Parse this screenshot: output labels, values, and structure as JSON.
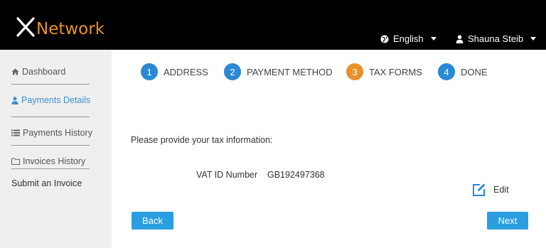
{
  "brand": {
    "logo_x": "X",
    "logo_text": "Network",
    "logo_color": "#e8912a"
  },
  "header": {
    "language": {
      "label": "English",
      "icon": "globe-icon"
    },
    "user": {
      "label": "Shauna Steib",
      "icon": "user-icon"
    }
  },
  "sidebar": {
    "items": [
      {
        "label": "Dashboard",
        "icon": "home-icon",
        "active": false
      },
      {
        "label": "Payments Details",
        "icon": "user-icon",
        "active": true
      },
      {
        "label": "Payments History",
        "icon": "list-icon",
        "active": false
      },
      {
        "label": "Invoices History",
        "icon": "folder-icon",
        "active": false
      },
      {
        "label": "Submit an Invoice",
        "icon": "",
        "active": false
      }
    ]
  },
  "steps": [
    {
      "num": "1",
      "label": "ADDRESS",
      "state": "done",
      "color": "#2a88d4"
    },
    {
      "num": "2",
      "label": "PAYMENT METHOD",
      "state": "done",
      "color": "#2a88d4"
    },
    {
      "num": "3",
      "label": "TAX FORMS",
      "state": "current",
      "color": "#e8912a"
    },
    {
      "num": "4",
      "label": "DONE",
      "state": "todo",
      "color": "#2a88d4"
    }
  ],
  "content": {
    "prompt": "Please provide your tax information:",
    "vat_label": "VAT ID Number",
    "vat_value": "GB192497368",
    "edit_label": "Edit"
  },
  "buttons": {
    "back": "Back",
    "next": "Next",
    "color": "#2a9ee0"
  },
  "colors": {
    "header_bg": "#000000",
    "sidebar_bg": "#efefef",
    "accent_blue": "#2a88d4",
    "accent_orange": "#e8912a"
  }
}
